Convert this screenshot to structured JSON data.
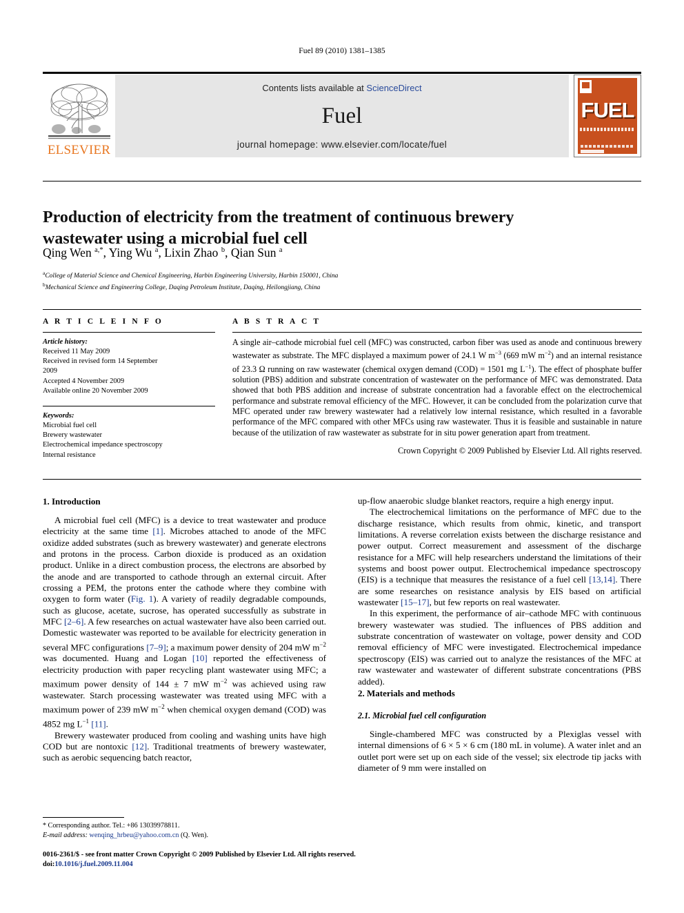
{
  "running_head": "Fuel 89 (2010) 1381–1385",
  "masthead": {
    "contents_prefix": "Contents lists available at ",
    "sciencedirect": "ScienceDirect",
    "journal_name": "Fuel",
    "homepage": "journal homepage: www.elsevier.com/locate/fuel",
    "publisher_logo_text": "ELSEVIER",
    "cover_title": "FUEL",
    "brand_orange": "#E87722",
    "cover_orange": "#C8501E",
    "link_blue": "#2a4b9b"
  },
  "article": {
    "title": "Production of electricity from the treatment of continuous brewery wastewater using a microbial fuel cell",
    "authors_html": "Qing Wen <sup>a,</sup><sup>*</sup>, Ying Wu <sup>a</sup>, Lixin Zhao <sup>b</sup>, Qian Sun <sup>a</sup>",
    "affiliations": [
      {
        "marker": "a",
        "text": "College of Material Science and Chemical Engineering, Harbin Engineering University, Harbin 150001, China"
      },
      {
        "marker": "b",
        "text": "Mechanical Science and Engineering College, Daqing Petroleum Institute, Daqing, Heilongjiang, China"
      }
    ]
  },
  "info": {
    "heading": "A R T I C L E    I N F O",
    "history_label": "Article history:",
    "history": [
      "Received 11 May 2009",
      "Received in revised form 14 September",
      "2009",
      "Accepted 4 November 2009",
      "Available online 20 November 2009"
    ],
    "keywords_label": "Keywords:",
    "keywords": [
      "Microbial fuel cell",
      "Brewery wastewater",
      "Electrochemical impedance spectroscopy",
      "Internal resistance"
    ]
  },
  "abstract": {
    "heading": "A B S T R A C T",
    "text_html": "A single air–cathode microbial fuel cell (MFC) was constructed, carbon fiber was used as anode and continuous brewery wastewater as substrate. The MFC displayed a maximum power of 24.1 W m<sup>−3</sup> (669 mW m<sup>−2</sup>) and an internal resistance of 23.3 Ω running on raw wastewater (chemical oxygen demand (COD) = 1501 mg L<sup>−1</sup>). The effect of phosphate buffer solution (PBS) addition and substrate concentration of wastewater on the performance of MFC was demonstrated. Data showed that both PBS addition and increase of substrate concentration had a favorable effect on the electrochemical performance and substrate removal efficiency of the MFC. However, it can be concluded from the polarization curve that MFC operated under raw brewery wastewater had a relatively low internal resistance, which resulted in a favorable performance of the MFC compared with other MFCs using raw wastewater. Thus it is feasible and sustainable in nature because of the utilization of raw wastewater as substrate for in situ power generation apart from treatment.",
    "copyright": "Crown Copyright © 2009 Published by Elsevier Ltd. All rights reserved."
  },
  "body": {
    "left": [
      {
        "type": "head",
        "text": "1. Introduction"
      },
      {
        "type": "para",
        "html": "A microbial fuel cell (MFC) is a device to treat wastewater and produce electricity at the same time <span class=\"ref\">[1]</span>. Microbes attached to anode of the MFC oxidize added substrates (such as brewery wastewater) and generate electrons and protons in the process. Carbon dioxide is produced as an oxidation product. Unlike in a direct combustion process, the electrons are absorbed by the anode and are transported to cathode through an external circuit. After crossing a PEM, the protons enter the cathode where they combine with oxygen to form water (<span class=\"ref\">Fig. 1</span>). A variety of readily degradable compounds, such as glucose, acetate, sucrose, has operated successfully as substrate in MFC <span class=\"ref\">[2–6]</span>. A few researches on actual wastewater have also been carried out. Domestic wastewater was reported to be available for electricity generation in several MFC configurations <span class=\"ref\">[7–9]</span>; a maximum power density of 204 mW m<sup>−2</sup> was documented. Huang and Logan <span class=\"ref\">[10]</span> reported the effectiveness of electricity production with paper recycling plant wastewater using MFC; a maximum power density of 144 ± 7 mW m<sup>−2</sup> was achieved using raw wastewater. Starch processing wastewater was treated using MFC with a maximum power of 239 mW m<sup>−2</sup> when chemical oxygen demand (COD) was 4852 mg L<sup>−1</sup> <span class=\"ref\">[11]</span>."
      },
      {
        "type": "para",
        "html": "Brewery wastewater produced from cooling and washing units have high COD but are nontoxic <span class=\"ref\">[12]</span>. Traditional treatments of brewery wastewater, such as aerobic sequencing batch reactor,"
      }
    ],
    "right": [
      {
        "type": "para-cont",
        "html": "up-flow anaerobic sludge blanket reactors, require a high energy input."
      },
      {
        "type": "para",
        "html": "The electrochemical limitations on the performance of MFC due to the discharge resistance, which results from ohmic, kinetic, and transport limitations. A reverse correlation exists between the discharge resistance and power output. Correct measurement and assessment of the discharge resistance for a MFC will help researchers understand the limitations of their systems and boost power output. Electrochemical impedance spectroscopy (EIS) is a technique that measures the resistance of a fuel cell <span class=\"ref\">[13,14]</span>. There are some researches on resistance analysis by EIS based on artificial wastewater <span class=\"ref\">[15–17]</span>, but few reports on real wastewater."
      },
      {
        "type": "para",
        "html": "In this experiment, the performance of air–cathode MFC with continuous brewery wastewater was studied. The influences of PBS addition and substrate concentration of wastewater on voltage, power density and COD removal efficiency of MFC were investigated. Electrochemical impedance spectroscopy (EIS) was carried out to analyze the resistances of the MFC at raw wastewater and wastewater of different substrate concentrations (PBS added)."
      },
      {
        "type": "head",
        "text": "2. Materials and methods"
      },
      {
        "type": "subhead",
        "text": "2.1. Microbial fuel cell configuration"
      },
      {
        "type": "para",
        "html": "Single-chambered MFC was constructed by a Plexiglas vessel with internal dimensions of 6 × 5 × 6 cm (180 mL in volume). A water inlet and an outlet port were set up on each side of the vessel; six electrode tip jacks with diameter of 9 mm were installed on"
      }
    ]
  },
  "footnote": {
    "corresponding_html": "<span class=\"star\">*</span> Corresponding author. Tel.: +86 13039978811.",
    "email_label": "E-mail address:",
    "email": "wenqing_hrbeu@yahoo.com.cn",
    "email_suffix": "(Q. Wen)."
  },
  "imprint": {
    "line1": "0016-2361/$ - see front matter Crown Copyright © 2009 Published by Elsevier Ltd. All rights reserved.",
    "doi_label": "doi:",
    "doi": "10.1016/j.fuel.2009.11.004"
  }
}
